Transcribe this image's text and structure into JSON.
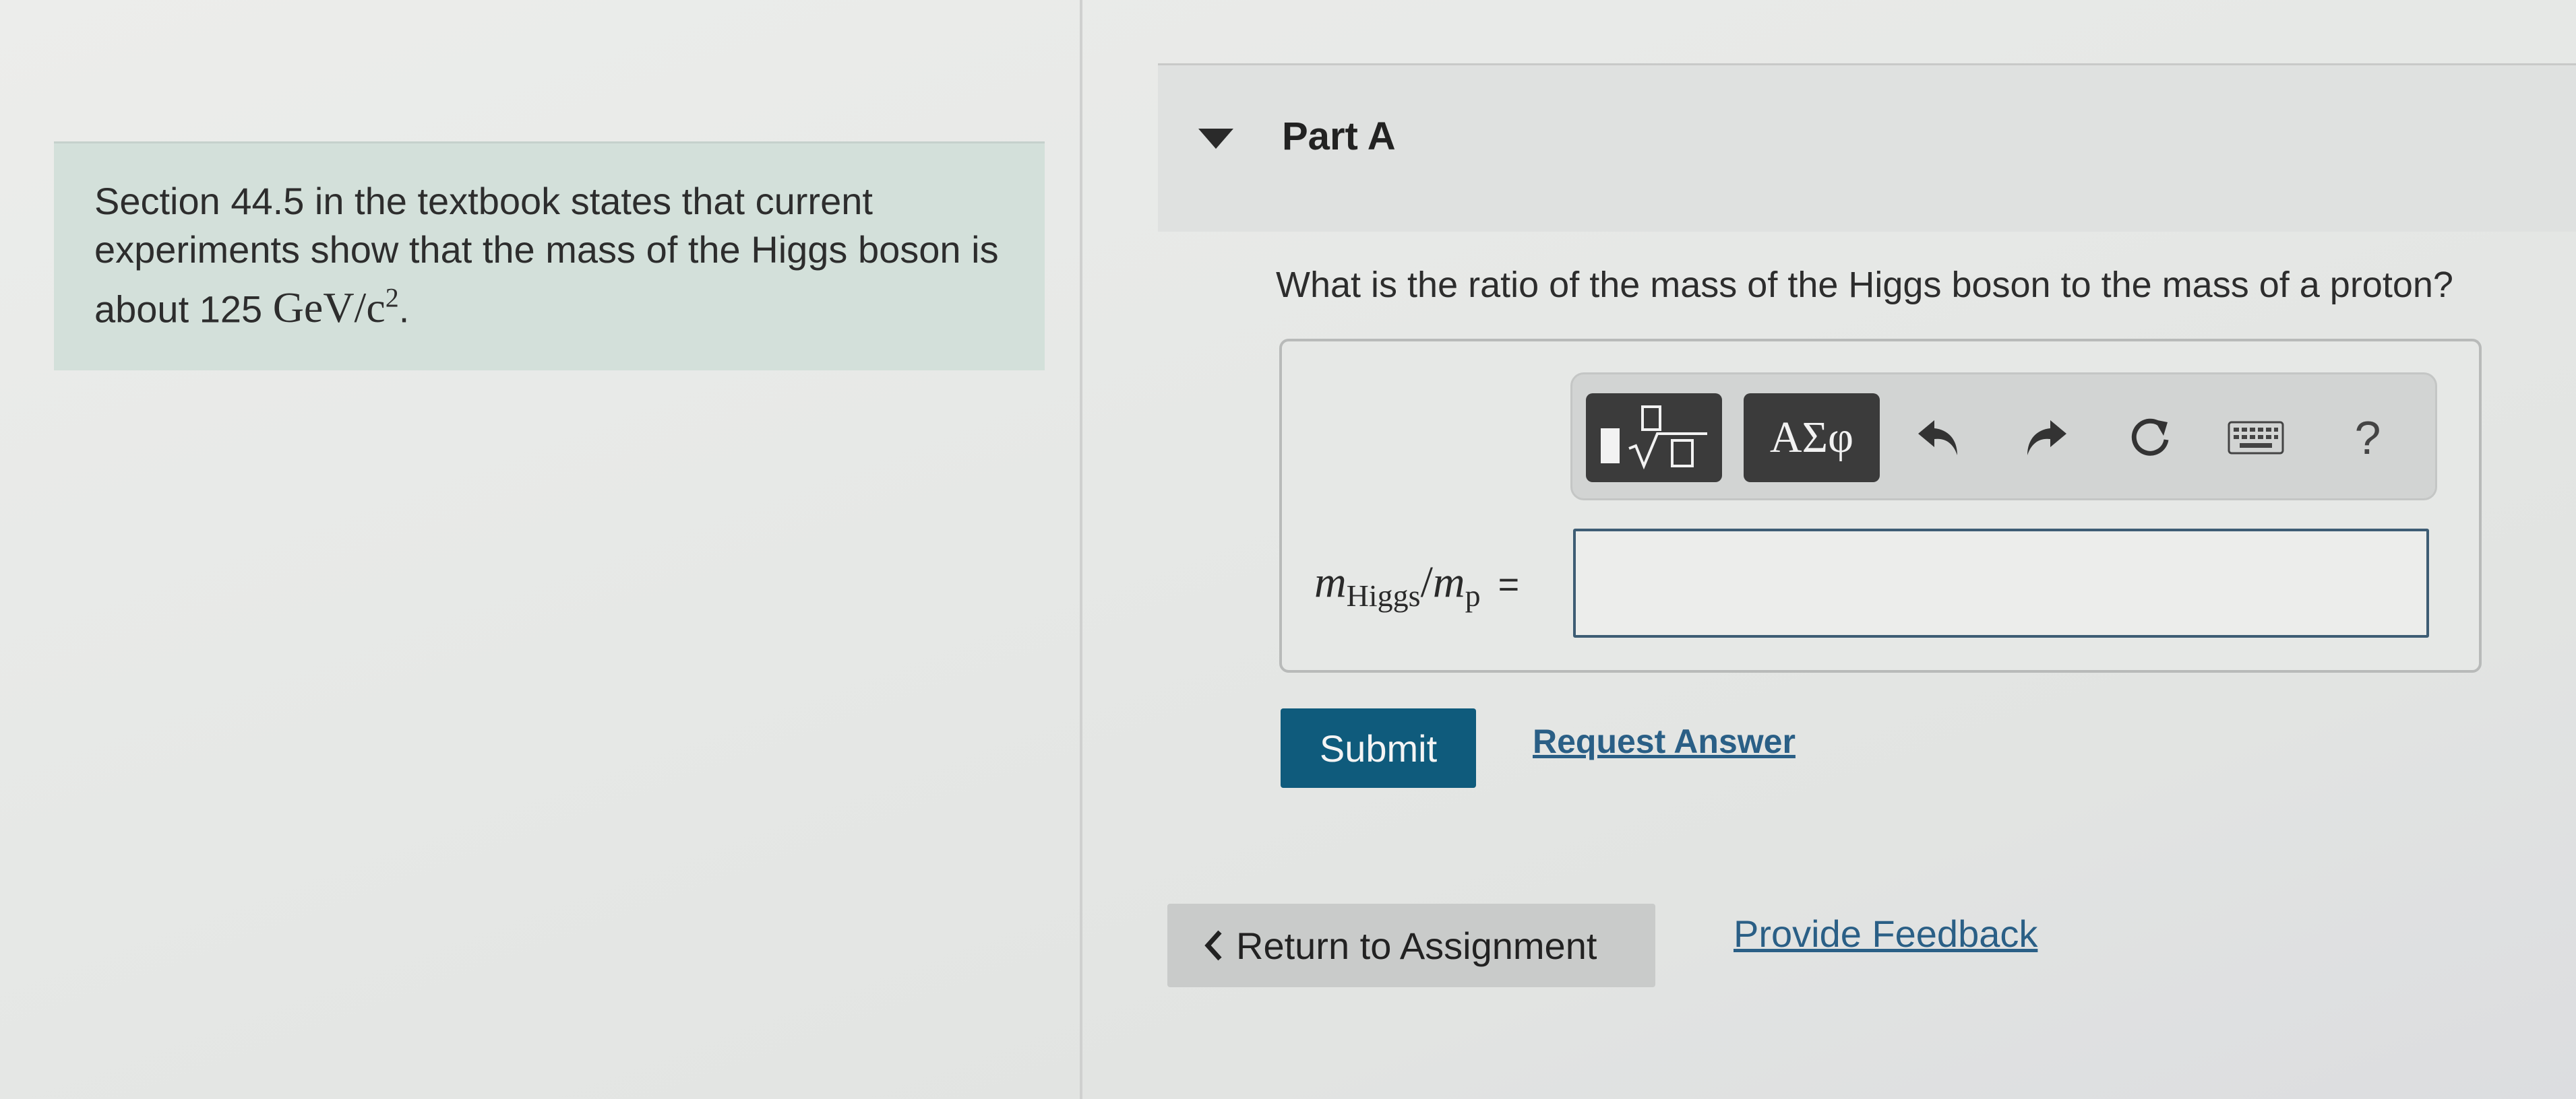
{
  "intro": {
    "text": "Section 44.5 in the textbook states that current experiments show that the mass of the Higgs boson is about 125",
    "unit": "GeV/c",
    "exponent": "2",
    "end": "."
  },
  "part": {
    "title": "Part A"
  },
  "question": "What is the ratio of the mass of the Higgs boson to the mass of a proton?",
  "toolbar": {
    "templates_icon": "fraction-sqrt-templates-icon",
    "greek_label": "ΑΣφ",
    "undo_icon": "undo-icon",
    "redo_icon": "redo-icon",
    "reset_icon": "reset-icon",
    "keyboard_icon": "keyboard-icon",
    "help_label": "?"
  },
  "equation": {
    "var1": "m",
    "sub1": "Higgs",
    "slash": "/",
    "var2": "m",
    "sub2": "p",
    "equals": "="
  },
  "answer": {
    "value": ""
  },
  "actions": {
    "submit_label": "Submit",
    "request_answer_label": "Request Answer"
  },
  "footer": {
    "return_label": "Return to Assignment",
    "feedback_label": "Provide Feedback"
  },
  "colors": {
    "submit_bg": "#0f5b7c",
    "link": "#2a5f86",
    "intro_bg": "#d3e0da"
  }
}
